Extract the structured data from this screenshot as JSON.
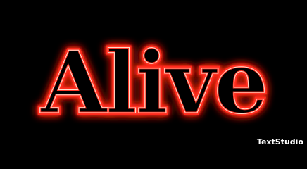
{
  "image": {
    "text": "Alive",
    "watermark": "TextStudio",
    "colors": {
      "background": "#000000",
      "glow": "#ff2a1a",
      "outline": "#ff3b2b",
      "inner_line": "#ffd9c9",
      "watermark": "#ffffff"
    },
    "style": "neon outline"
  }
}
